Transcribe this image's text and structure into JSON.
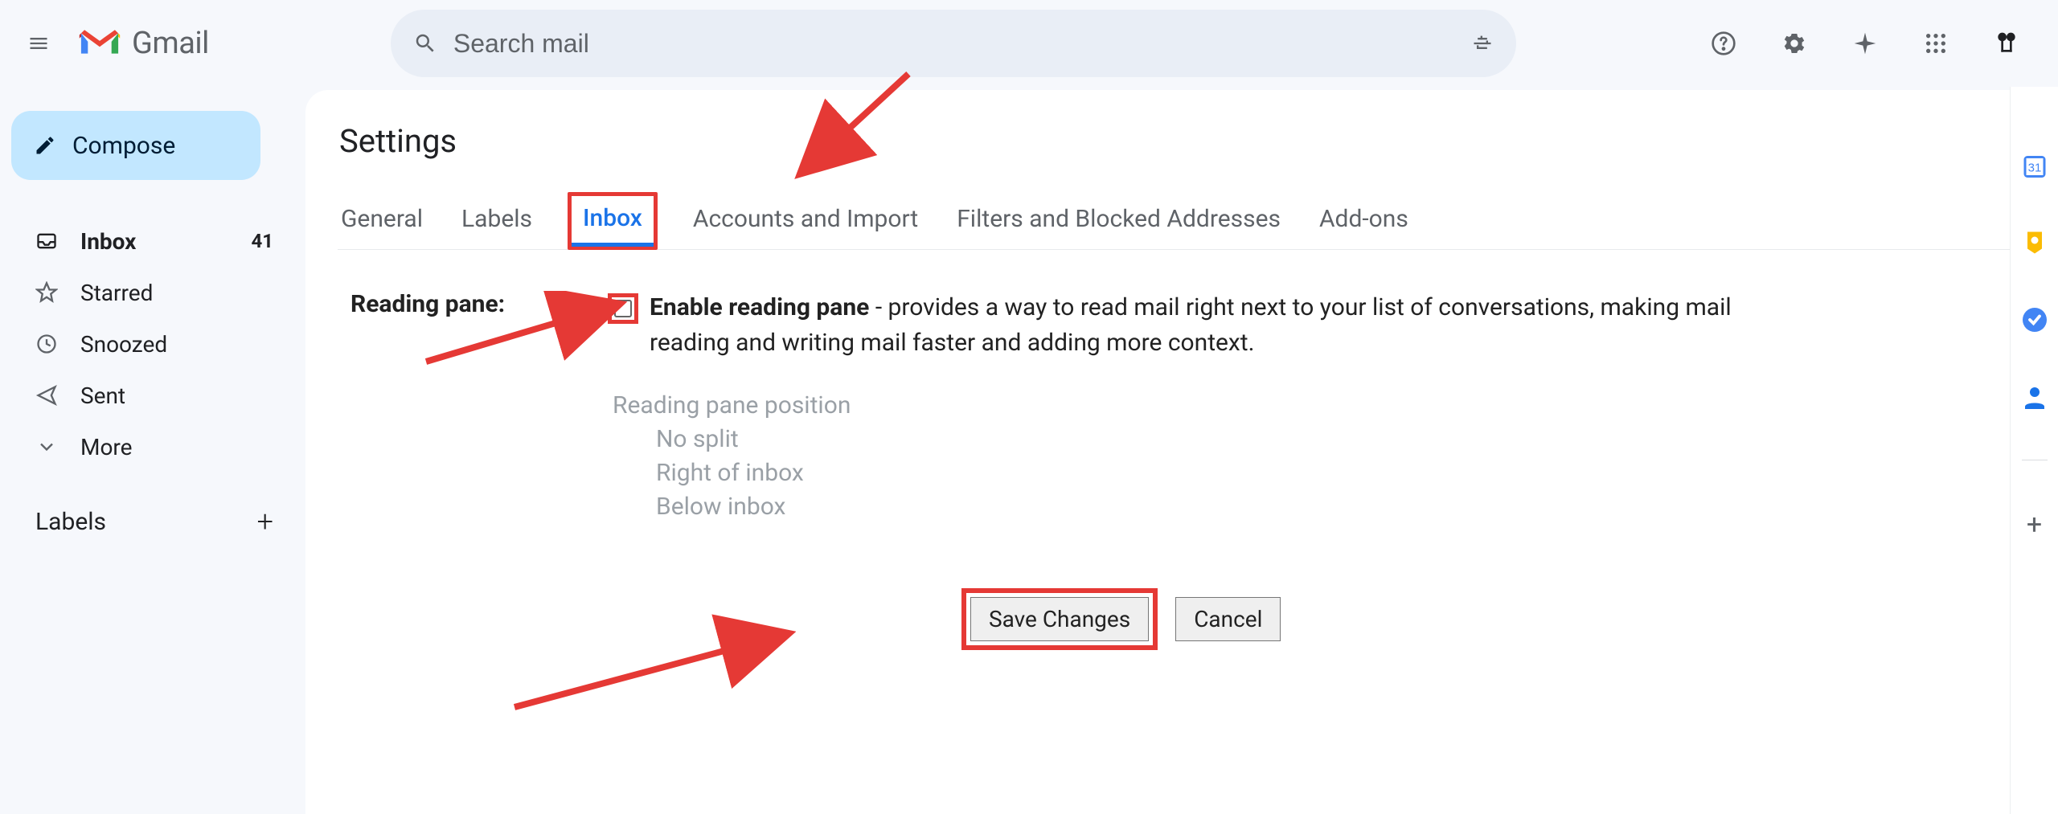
{
  "header": {
    "app_name": "Gmail",
    "search_placeholder": "Search mail"
  },
  "sidebar": {
    "compose_label": "Compose",
    "items": [
      {
        "label": "Inbox",
        "count": "41"
      },
      {
        "label": "Starred"
      },
      {
        "label": "Snoozed"
      },
      {
        "label": "Sent"
      },
      {
        "label": "More"
      }
    ],
    "labels_heading": "Labels"
  },
  "main": {
    "page_title": "Settings",
    "tabs": [
      {
        "label": "General"
      },
      {
        "label": "Labels"
      },
      {
        "label": "Inbox"
      },
      {
        "label": "Accounts and Import"
      },
      {
        "label": "Filters and Blocked Addresses"
      },
      {
        "label": "Add-ons"
      }
    ],
    "reading_pane": {
      "label": "Reading pane:",
      "checkbox_label": "Enable reading pane",
      "description": " - provides a way to read mail right next to your list of conversations, making mail reading and writing mail faster and adding more context.",
      "position_heading": "Reading pane position",
      "options": [
        "No split",
        "Right of inbox",
        "Below inbox"
      ]
    },
    "buttons": {
      "save": "Save Changes",
      "cancel": "Cancel"
    }
  }
}
